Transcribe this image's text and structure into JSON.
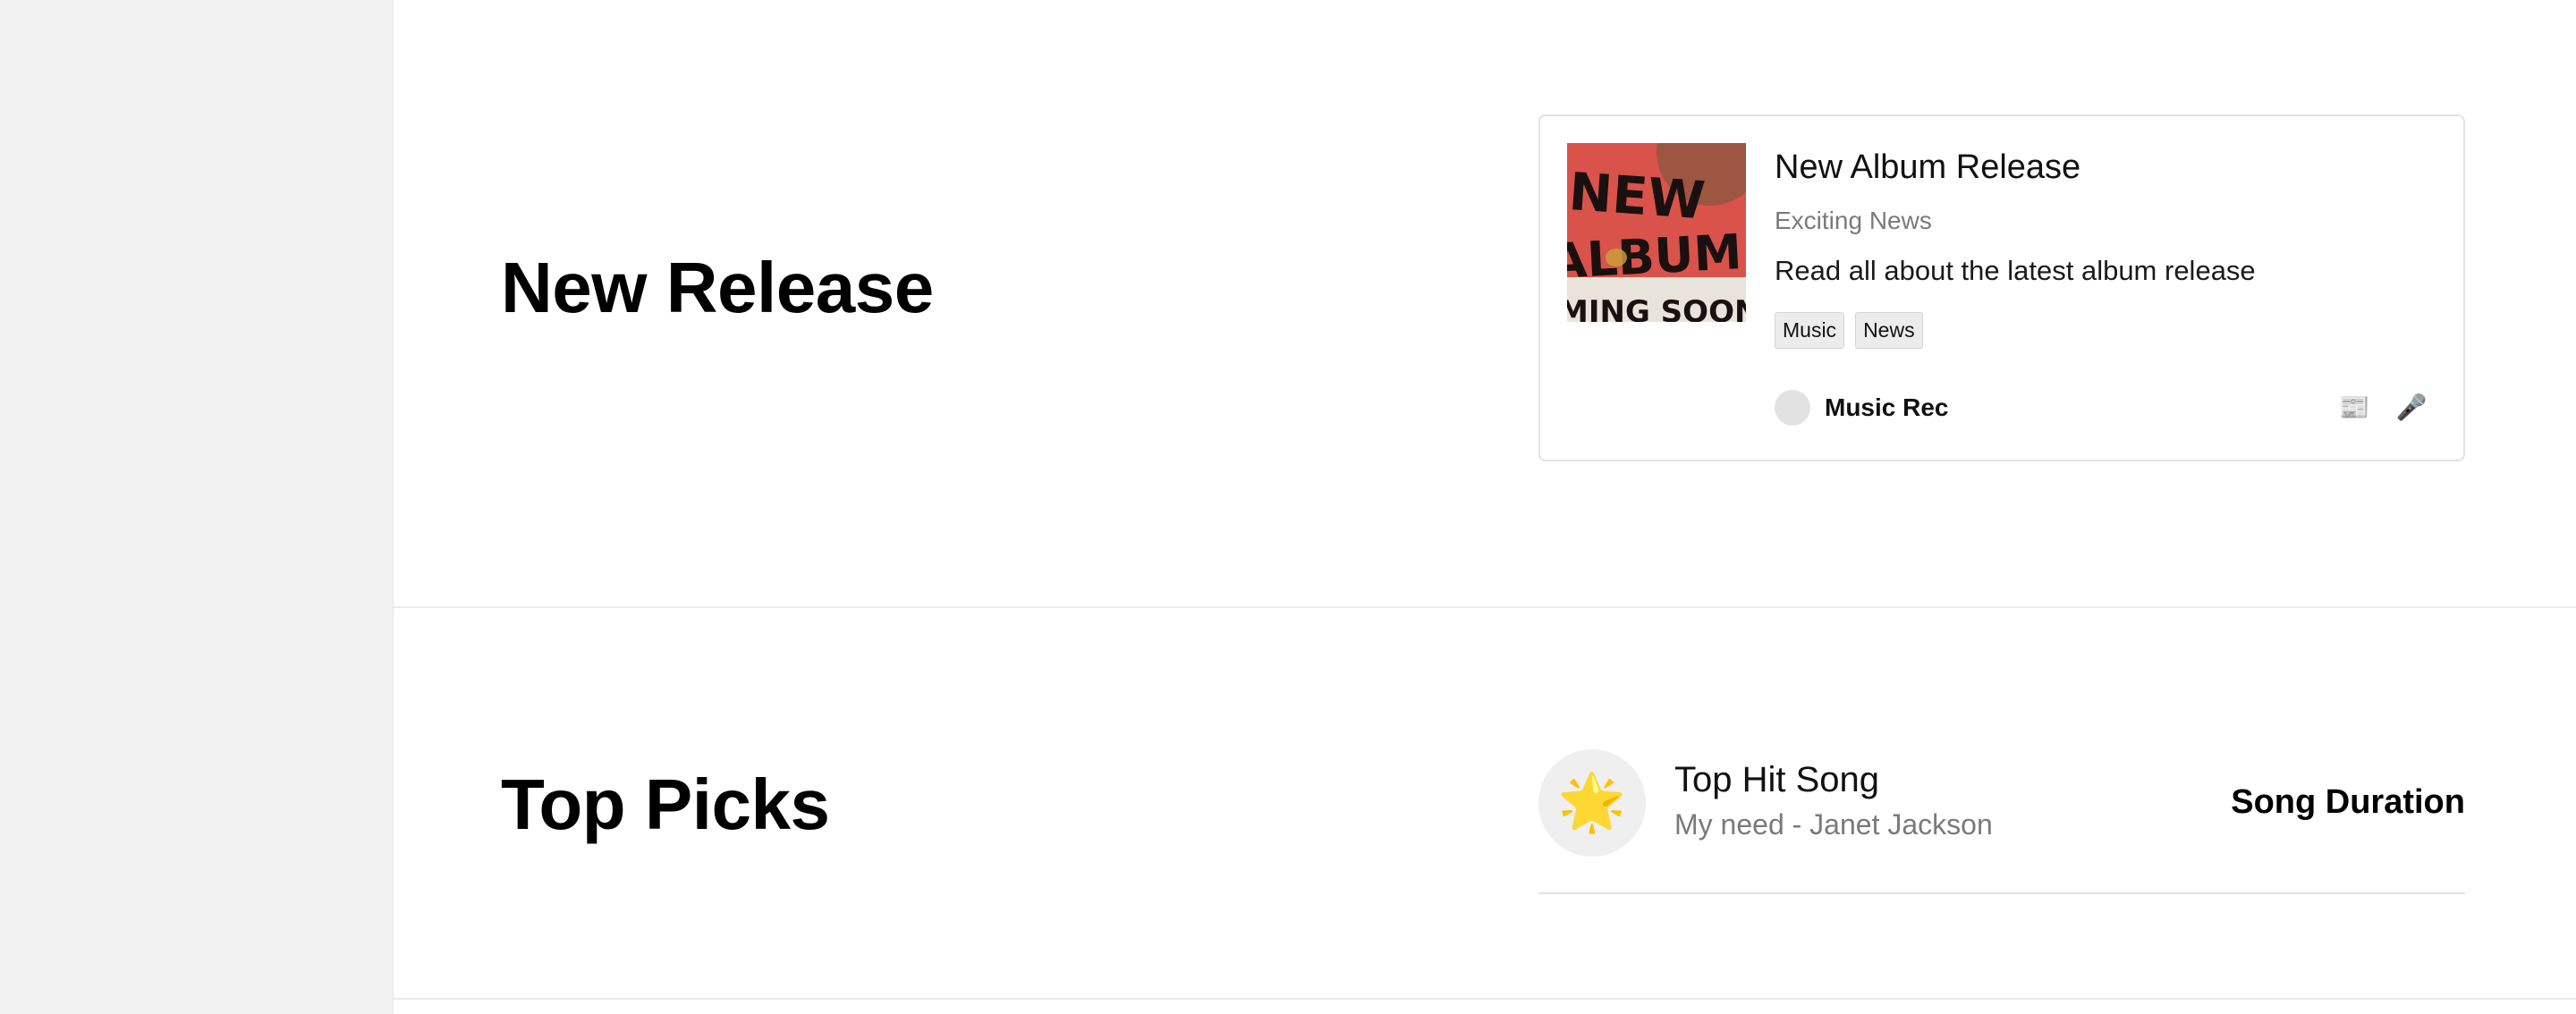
{
  "sections": {
    "new_release": {
      "title": "New Release",
      "card": {
        "title": "New Album Release",
        "subtitle": "Exciting News",
        "description": "Read all about the latest album release",
        "tags": [
          "Music",
          "News"
        ],
        "author": "Music Rec",
        "cover_text": "NEW ALBUM COMING SOON",
        "icons": [
          "newspaper-icon",
          "microphone-icon"
        ]
      }
    },
    "top_picks": {
      "title": "Top Picks",
      "item": {
        "icon": "star-icon",
        "title": "Top Hit Song",
        "artist": "My need - Janet Jackson",
        "duration": "Song Duration"
      }
    }
  },
  "colors": {
    "sidebar_bg": "#f2f2f2",
    "cover_bg": "#d9534a",
    "muted_text": "#7a7a7a"
  }
}
